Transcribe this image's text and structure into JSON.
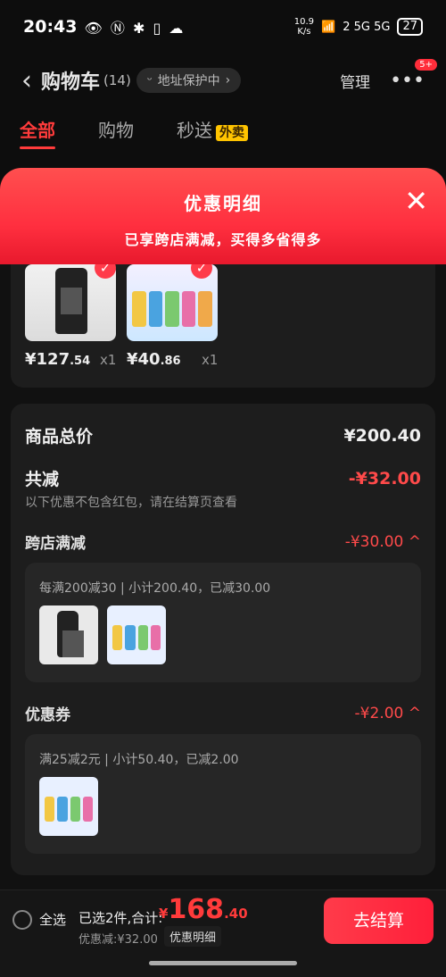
{
  "status": {
    "time": "20:43",
    "speed": "10.9\nK/s",
    "network": "2 5G 5G",
    "battery": "27"
  },
  "header": {
    "title": "购物车",
    "count": "(14)",
    "address_pill": "地址保护中",
    "manage": "管理",
    "more_badge": "5+"
  },
  "tabs": [
    {
      "label": "全部"
    },
    {
      "label": "购物"
    },
    {
      "label": "秒送"
    }
  ],
  "tab_waimai_badge": "外卖",
  "banner": {
    "title": "优惠明细",
    "subtitle": "已享跨店满减，买得多省得多"
  },
  "products": [
    {
      "price_int": "¥127",
      "price_dec": ".54",
      "qty": "x1"
    },
    {
      "price_int": "¥40",
      "price_dec": ".86",
      "qty": "x1"
    }
  ],
  "detail": {
    "total_label": "商品总价",
    "total_value": "¥200.40",
    "reduced_label": "共减",
    "reduced_value": "-¥32.00",
    "note": "以下优惠不包含红包，请在结算页查看",
    "cross_label": "跨店满减",
    "cross_value": "-¥30.00 ^",
    "cross_desc": "每满200减30 | 小计200.40，已减30.00",
    "coupon_label": "优惠券",
    "coupon_value": "-¥2.00 ^",
    "coupon_desc": "满25减2元 | 小计50.40，已减2.00"
  },
  "bottom": {
    "select_all": "全选",
    "selected": "已选2件,合计:",
    "yen": "¥",
    "total_int": "168",
    "total_dec": ".40",
    "discount": "优惠减:¥32.00",
    "detail_btn": "优惠明细",
    "checkout": "去结算"
  }
}
